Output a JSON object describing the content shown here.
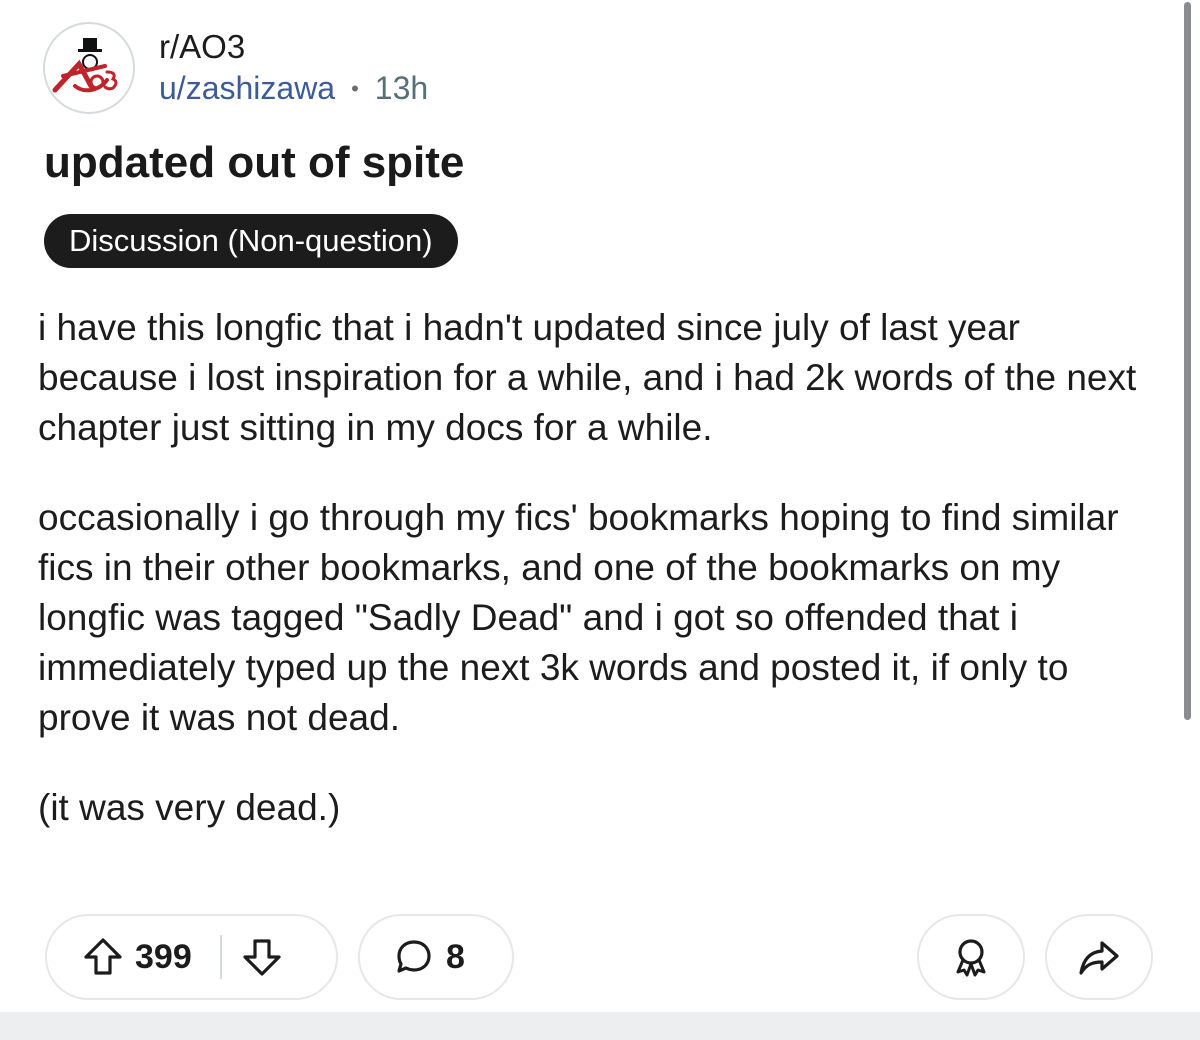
{
  "post": {
    "subreddit": "r/AO3",
    "username": "u/zashizawa",
    "separator": "•",
    "age": "13h",
    "title": "updated out of spite",
    "flair": "Discussion (Non-question)",
    "paragraphs": [
      "i have this longfic that i hadn't updated since july of last year because i lost inspiration for a while, and i had 2k words of the next chapter just sitting in my docs for a while.",
      "occasionally i go through my fics' bookmarks hoping to find similar fics in their other bookmarks, and one of the bookmarks on my longfic was tagged \"Sadly Dead\" and i got so offended that i immediately typed up the next 3k words and posted it, if only to prove it was not dead.",
      "(it was very dead.)"
    ]
  },
  "actions": {
    "upvote_icon": "arrow-up-icon",
    "vote_count": "399",
    "downvote_icon": "arrow-down-icon",
    "comment_icon": "speech-bubble-icon",
    "comment_count": "8",
    "award_icon": "award-icon",
    "share_icon": "share-arrow-icon"
  },
  "colors": {
    "username": "#3d5a99",
    "flair_bg": "#1c1c1c",
    "pill_border": "#e5e7e8",
    "logo_red": "#c0242b"
  },
  "avatar": {
    "icon": "ao3-logo-icon",
    "logo_text": "AO3"
  }
}
